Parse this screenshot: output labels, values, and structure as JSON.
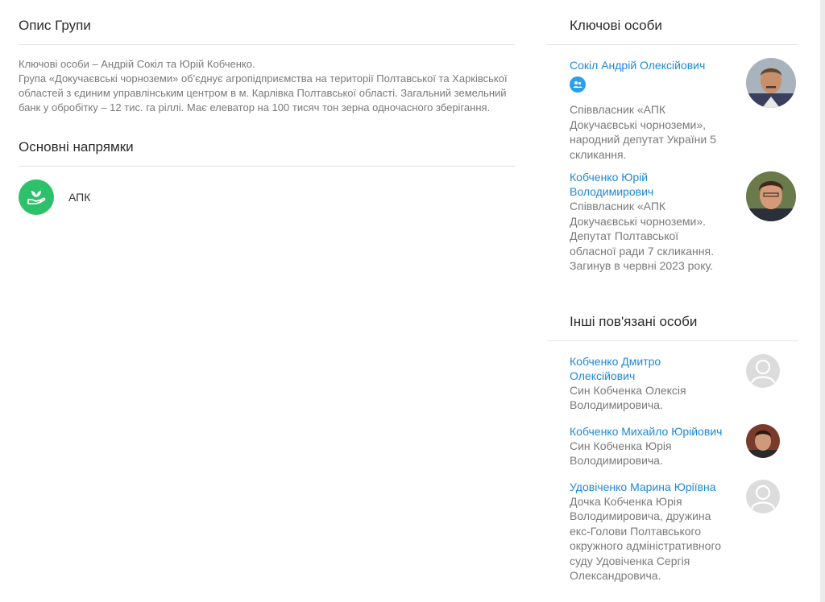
{
  "group": {
    "description_title": "Опис Групи",
    "description_lines": [
      "Ключові особи – Андрій Сокіл та Юрій Кобченко.",
      "Група «Докучаєвські чорноземи» об'єднує агропідприємства на території Полтавської та Харківської областей з єдиним управлінським центром в м. Карлівка Полтавської області. Загальний земельний банк у обробітку – 12 тис. га ріллі. Має елеватор на 100 тисяч тон зерна одночасного зберігання."
    ],
    "directions_title": "Основні напрямки",
    "directions": [
      {
        "label": "АПК",
        "icon": "plant-in-hand-icon",
        "color": "#2ec16b"
      }
    ]
  },
  "key_persons": {
    "title": "Ключові особи",
    "items": [
      {
        "name": "Сокіл Андрій Олексійович",
        "has_badge": true,
        "badge_icon": "people-icon",
        "description": "Співвласник «АПК Докучаєвські чорноземи», народний депутат України 5 скликання."
      },
      {
        "name": "Кобченко Юрій Володимирович",
        "has_badge": false,
        "description": "Співвласник «АПК Докучаєвські чорноземи». Депутат Полтавської обласної ради 7 скликання. Загинув в червні 2023 року."
      }
    ]
  },
  "related_persons": {
    "title": "Інші пов'язані особи",
    "items": [
      {
        "name": "Кобченко Дмитро Олексійович",
        "description": "Син Кобченка Олексія Володимировича.",
        "avatar": "placeholder"
      },
      {
        "name": "Кобченко Михайло Юрійович",
        "description": "Син Кобченка Юрія Володимировича.",
        "avatar": "photo"
      },
      {
        "name": "Удовіченко Марина Юріївна",
        "description": "Дочка Кобченка Юрія Володимировича, дружина екс-Голови Полтавського окружного адміністративного суду Удовіченка Сергія Олександровича.",
        "avatar": "placeholder"
      }
    ]
  },
  "colors": {
    "link": "#1e88d8",
    "muted": "#7a7a7a",
    "accent_green": "#2ec16b",
    "badge_blue": "#29a0e8"
  }
}
